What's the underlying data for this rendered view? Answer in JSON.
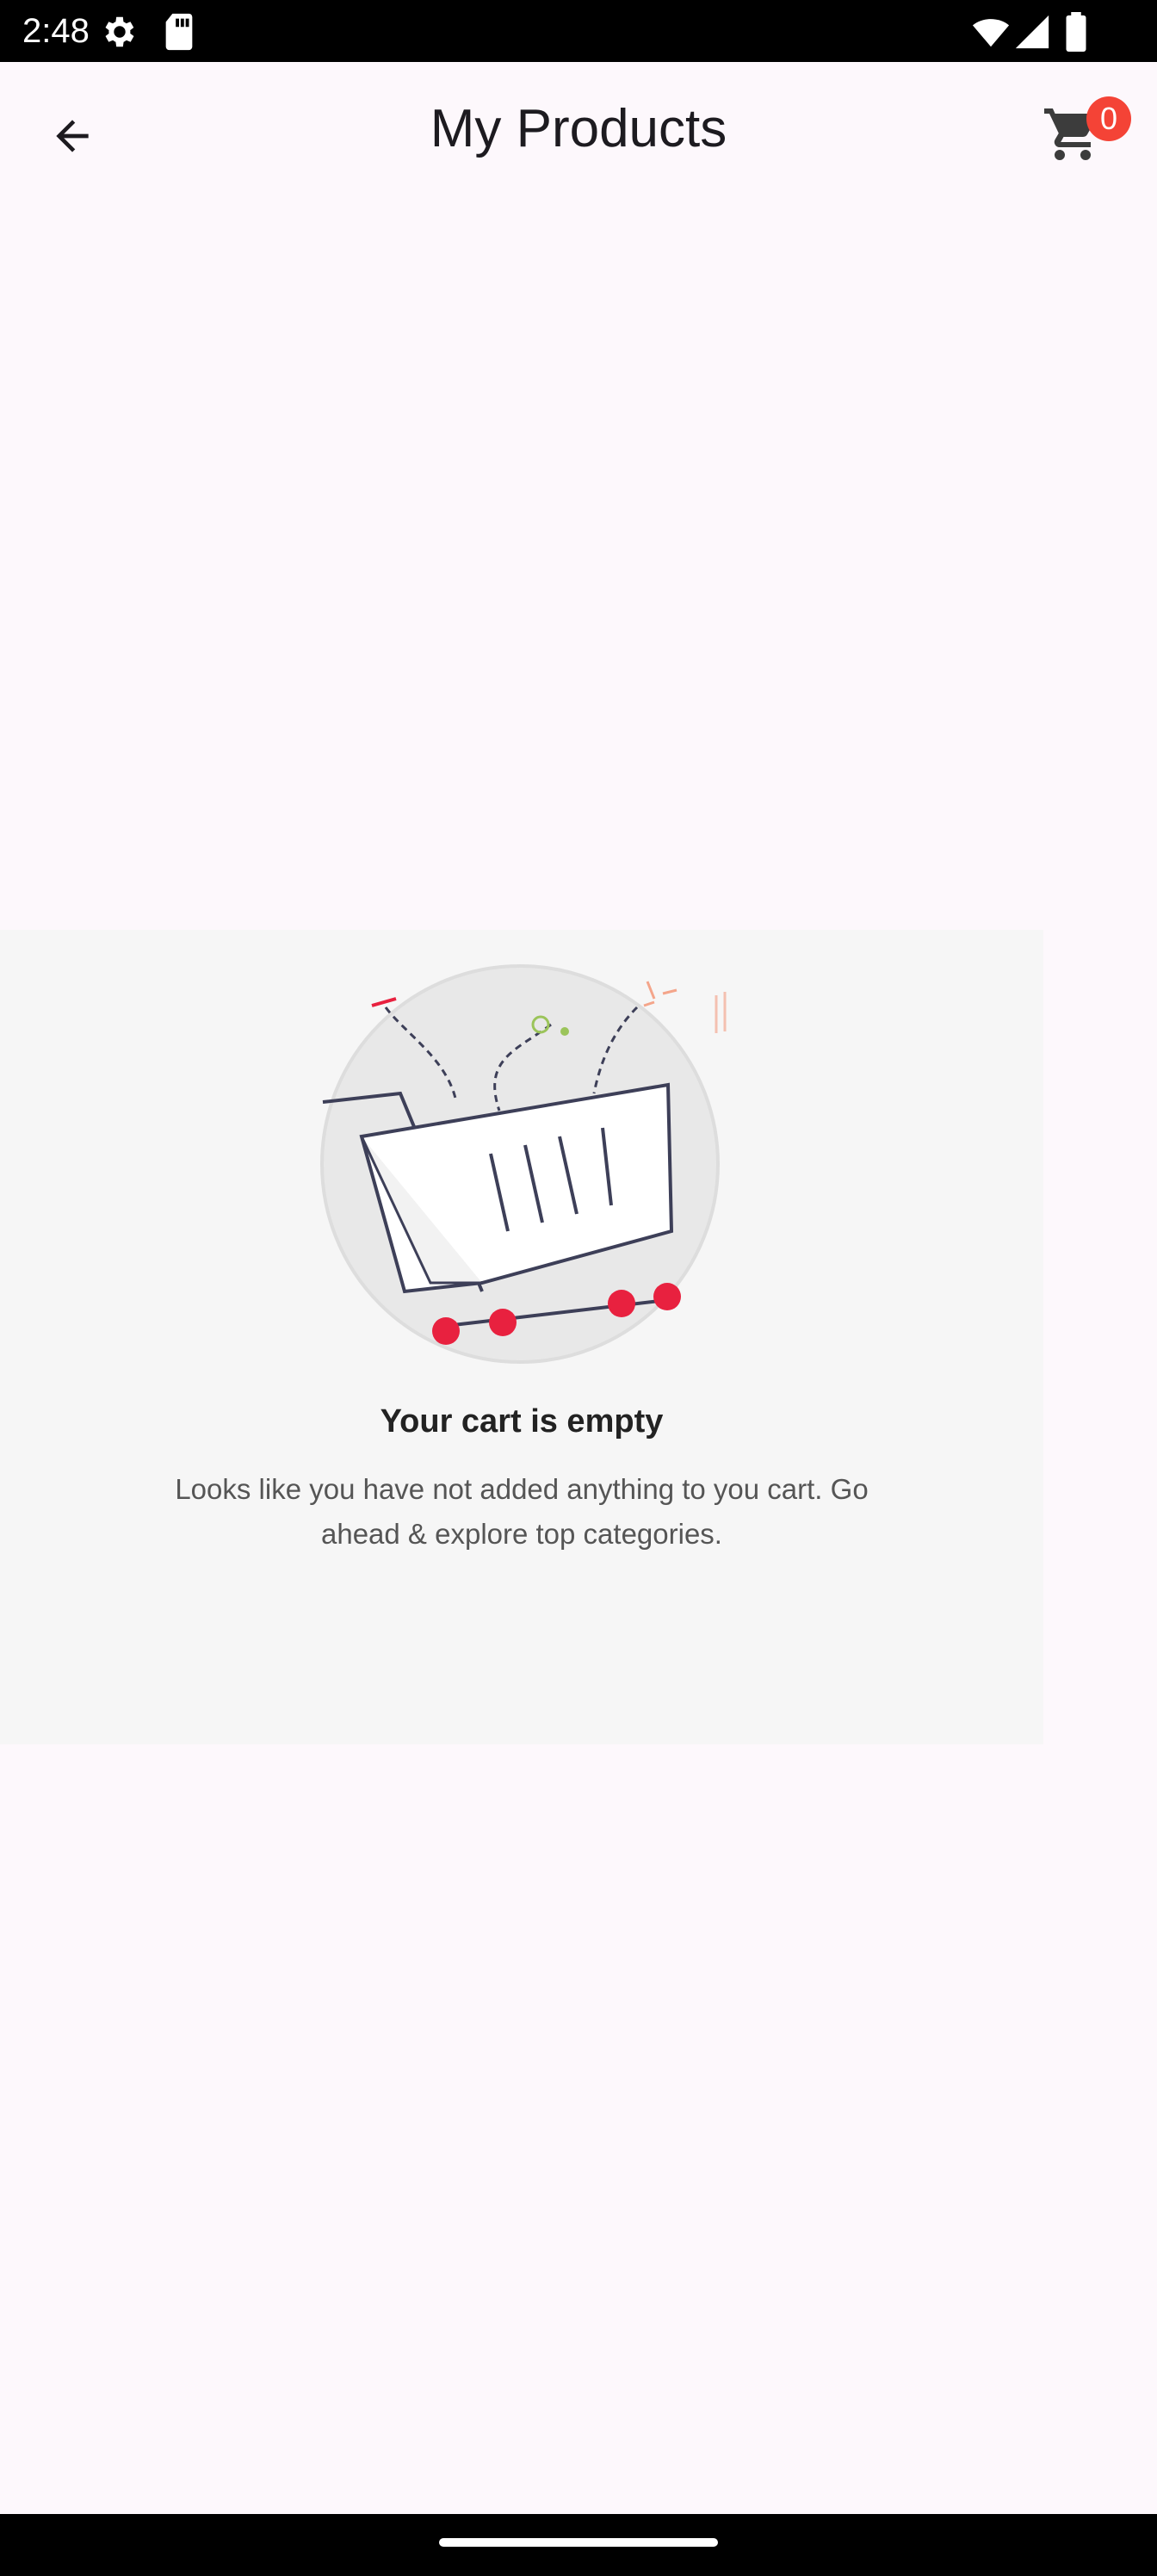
{
  "status_bar": {
    "time": "2:48",
    "icons": [
      "settings-icon",
      "sd-card-icon",
      "wifi-icon",
      "signal-icon",
      "battery-icon"
    ]
  },
  "app_bar": {
    "title": "My Products",
    "back_icon": "arrow-back-icon",
    "cart_icon": "shopping-cart-icon",
    "cart_count": "0"
  },
  "empty_state": {
    "title": "Your cart is empty",
    "message_line1": "Looks like you have not added anything to you cart. Go",
    "message_line2": "ahead & explore top categories.",
    "illustration": "empty-cart-illustration"
  },
  "colors": {
    "background": "#fdf8fc",
    "badge": "#f44336",
    "panel": "#f6f6f6",
    "accent_red": "#e8213f",
    "cart_outline": "#3d3f58"
  }
}
